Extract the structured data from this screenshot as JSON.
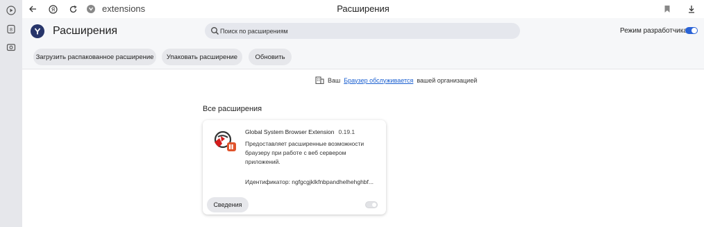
{
  "browser": {
    "url": "extensions",
    "tab_title": "Расширения"
  },
  "header": {
    "title": "Расширения",
    "search_placeholder": "Поиск по расширениям",
    "dev_mode_label": "Режим разработчика",
    "dev_mode_enabled": true
  },
  "toolbar": {
    "load_unpacked": "Загрузить распакованное расширение",
    "pack": "Упаковать расширение",
    "update": "Обновить"
  },
  "org_notice": {
    "prefix": "Ваш",
    "link": "Браузер обслуживается",
    "suffix": "вашей организацией"
  },
  "section_title": "Все расширения",
  "extensions": [
    {
      "name": "Global System Browser Extension",
      "version": "0.19.1",
      "description": "Предоставляет расширенные возможности браузеру при работе с веб сервером приложений.",
      "id_text": "Идентификатор: ngfgcgjklkfnbpandhelhehghbf...",
      "details_label": "Сведения",
      "enabled": false
    }
  ],
  "colors": {
    "accent": "#2a63d6",
    "link": "#1a5fd0",
    "header_bg": "#f6f7f9"
  }
}
